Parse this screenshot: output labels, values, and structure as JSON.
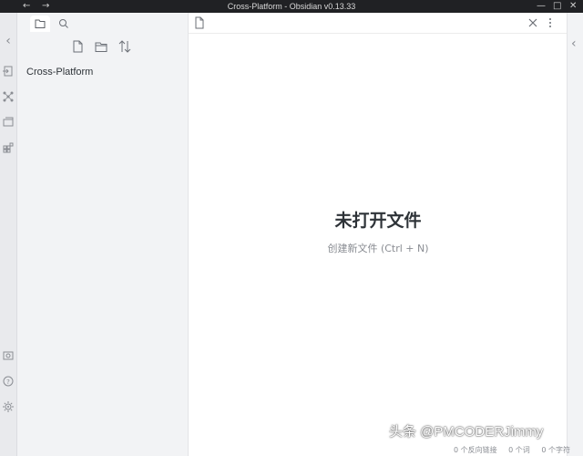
{
  "window": {
    "title": "Cross-Platform - Obsidian v0.13.33",
    "nav_back": "←",
    "nav_forward": "→",
    "minimize": "—",
    "maximize": "□",
    "close": "✕"
  },
  "ribbon": {
    "collapse_icon": "‹",
    "items": [
      "open-quick-switcher-icon",
      "graph-view-icon",
      "open-daily-note-icon",
      "command-palette-icon"
    ],
    "bottom_items": [
      "open-vault-icon",
      "help-icon",
      "settings-icon"
    ]
  },
  "sidebar": {
    "tabs": [
      "file-explorer-icon",
      "search-icon"
    ],
    "actions": [
      "new-note-icon",
      "new-folder-icon",
      "sort-icon"
    ],
    "files": [
      {
        "name": "Cross-Platform"
      }
    ]
  },
  "main": {
    "empty_title": "未打开文件",
    "empty_subtitle": "创建新文件 (Ctrl + N)"
  },
  "statusbar": {
    "backlinks": "0 个反向链接",
    "words": "0 个词",
    "chars": "0 个字符"
  },
  "watermark": "头条 @PMCODERJimmy",
  "colors": {
    "titlebar": "#202124",
    "sidebar_bg": "#f2f3f5",
    "main_bg": "#ffffff",
    "muted_text": "#8a8d93"
  }
}
